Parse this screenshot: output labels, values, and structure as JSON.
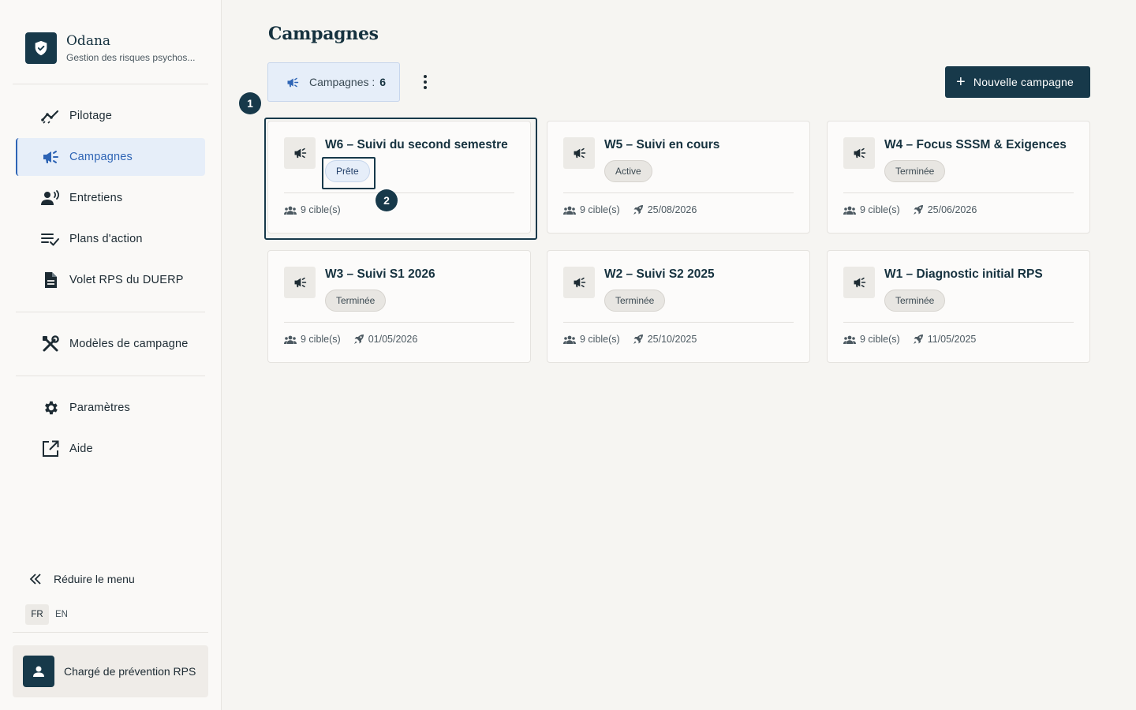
{
  "brand": {
    "name": "Odana",
    "subtitle": "Gestion des risques psychos..."
  },
  "nav": {
    "items": [
      {
        "label": "Pilotage",
        "icon": "trend-icon"
      },
      {
        "label": "Campagnes",
        "icon": "megaphone-icon",
        "active": true
      },
      {
        "label": "Entretiens",
        "icon": "person-voice-icon"
      },
      {
        "label": "Plans d'action",
        "icon": "checklist-icon"
      },
      {
        "label": "Volet RPS du DUERP",
        "icon": "document-icon"
      },
      {
        "label": "Modèles de campagne",
        "icon": "tools-icon"
      },
      {
        "label": "Paramètres",
        "icon": "gear-icon"
      },
      {
        "label": "Aide",
        "icon": "external-link-icon"
      }
    ],
    "collapse_label": "Réduire le menu"
  },
  "lang": {
    "fr": "FR",
    "en": "EN",
    "active": "FR"
  },
  "user": {
    "role": "Chargé de prévention RPS"
  },
  "main": {
    "title": "Campagnes",
    "count_label": "Campagnes :",
    "count_value": "6",
    "new_button": "Nouvelle campagne"
  },
  "markers": [
    "1",
    "2"
  ],
  "campaigns": [
    {
      "title": "W6 – Suivi du second semestre",
      "status": "Prête",
      "targets": "9 cible(s)",
      "date": ""
    },
    {
      "title": "W5 – Suivi en cours",
      "status": "Active",
      "targets": "9 cible(s)",
      "date": "25/08/2026"
    },
    {
      "title": "W4 – Focus SSSM & Exigences",
      "status": "Terminée",
      "targets": "9 cible(s)",
      "date": "25/06/2026"
    },
    {
      "title": "W3 – Suivi S1 2026",
      "status": "Terminée",
      "targets": "9 cible(s)",
      "date": "01/05/2026"
    },
    {
      "title": "W2 – Suivi S2 2025",
      "status": "Terminée",
      "targets": "9 cible(s)",
      "date": "25/10/2025"
    },
    {
      "title": "W1 – Diagnostic initial RPS",
      "status": "Terminée",
      "targets": "9 cible(s)",
      "date": "11/05/2025"
    }
  ],
  "colors": {
    "primary": "#17394a",
    "accent": "#2e64b5",
    "active_bg": "#e6eef9",
    "background": "#f6f5f2"
  }
}
